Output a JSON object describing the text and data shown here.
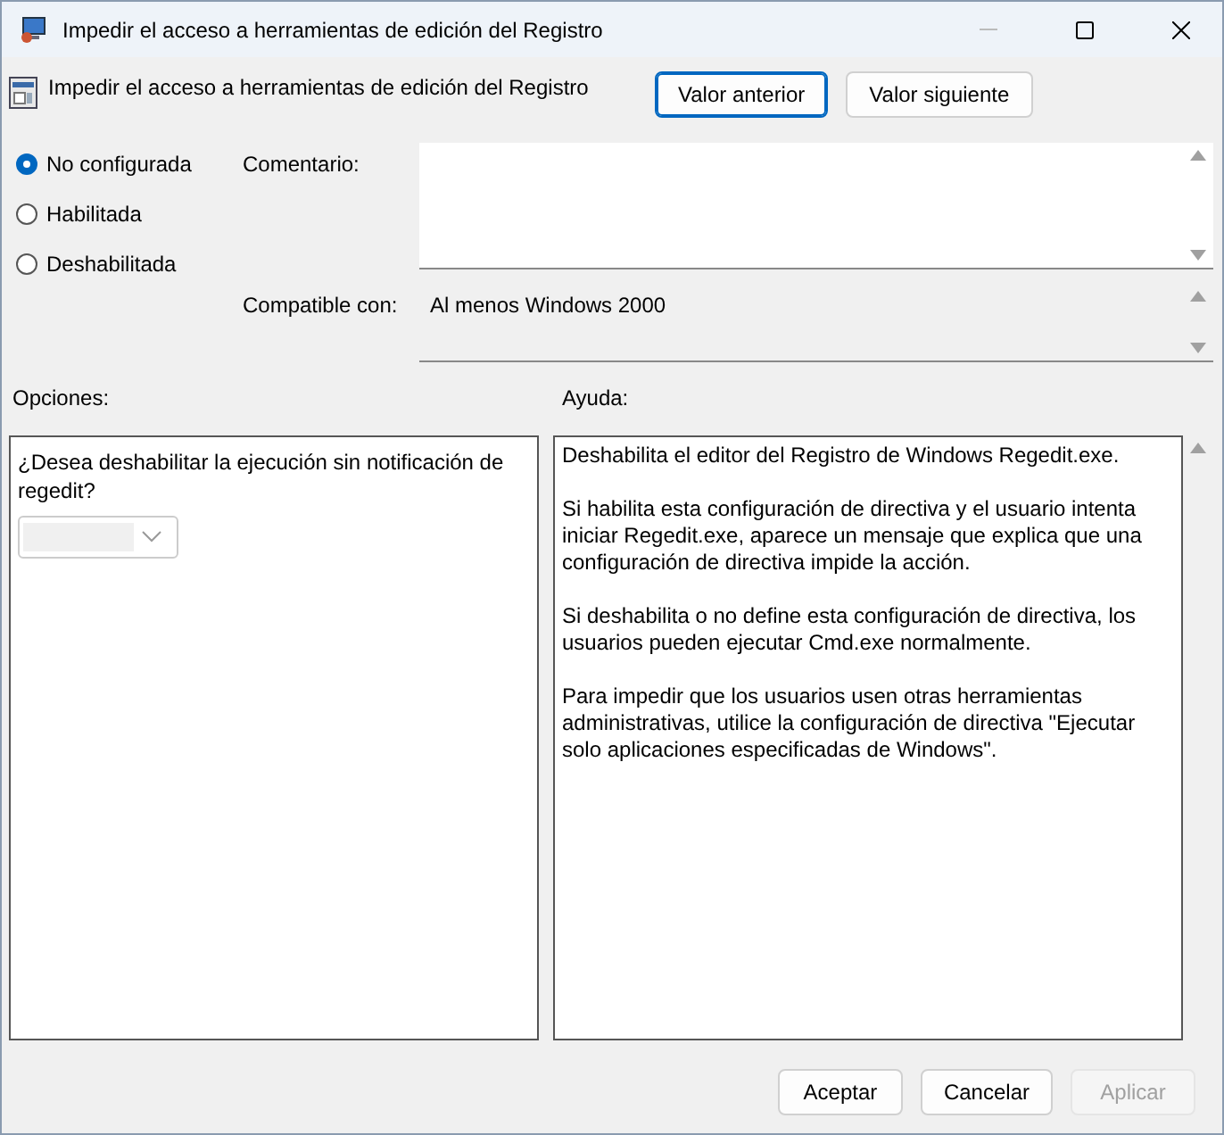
{
  "window": {
    "title": "Impedir el acceso a herramientas de edición del Registro"
  },
  "header": {
    "title": "Impedir el acceso a herramientas de edición del Registro",
    "buttons": [
      {
        "label": "Valor anterior",
        "focused": true
      },
      {
        "label": "Valor siguiente",
        "focused": false
      }
    ]
  },
  "states": [
    {
      "label": "No configurada",
      "selected": true
    },
    {
      "label": "Habilitada",
      "selected": false
    },
    {
      "label": "Deshabilitada",
      "selected": false
    }
  ],
  "comment": {
    "label": "Comentario:"
  },
  "supported": {
    "label": "Compatible con:",
    "value": "Al menos Windows 2000"
  },
  "options": {
    "label": "Opciones:",
    "question": "¿Desea deshabilitar la ejecución sin notificación de regedit?",
    "dropdown": {
      "disabled": true
    }
  },
  "help": {
    "label": "Ayuda:",
    "paragraphs": [
      "Deshabilita el editor del Registro de Windows Regedit.exe.",
      "Si habilita esta configuración de directiva y el usuario intenta iniciar Regedit.exe, aparece un mensaje que explica que una configuración de directiva impide la acción.",
      "Si deshabilita o no define esta configuración de directiva, los usuarios pueden ejecutar Cmd.exe normalmente.",
      "Para impedir que los usuarios usen otras herramientas administrativas, utilice la configuración de directiva \"Ejecutar solo aplicaciones especificadas de Windows\"."
    ]
  },
  "buttons": [
    {
      "label": "Aceptar",
      "disabled": false
    },
    {
      "label": "Cancelar",
      "disabled": false
    },
    {
      "label": "Aplicar",
      "disabled": true
    }
  ]
}
